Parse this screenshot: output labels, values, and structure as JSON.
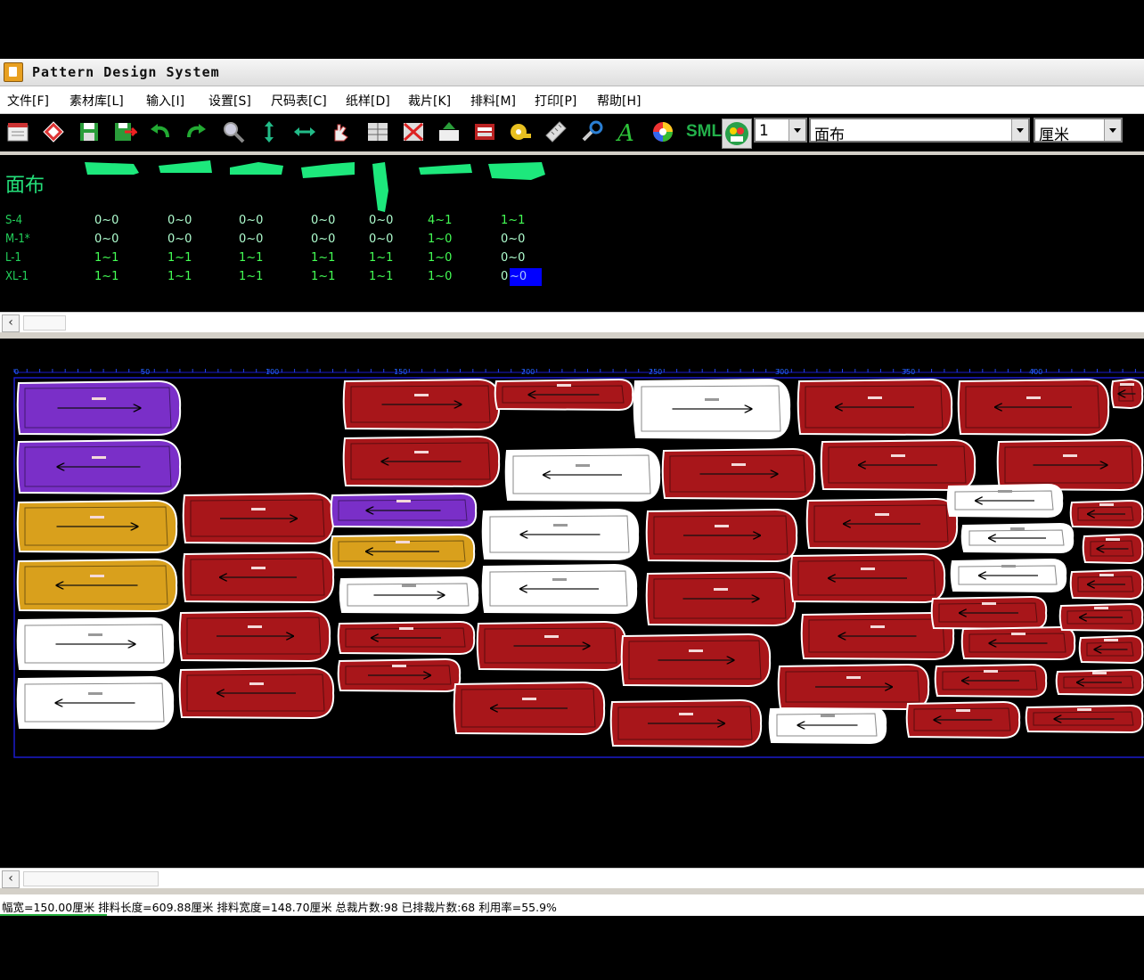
{
  "window": {
    "title": "Pattern Design System"
  },
  "menu": [
    "文件[F]",
    "素材库[L]",
    "输入[I]",
    "设置[S]",
    "尺码表[C]",
    "纸样[D]",
    "裁片[K]",
    "排料[M]",
    "打印[P]",
    "帮助[H]"
  ],
  "toolbar": {
    "icons": [
      "new-file-icon",
      "open-icon",
      "save-icon",
      "save-as-icon",
      "undo-icon",
      "redo-icon",
      "zoom-icon",
      "vertical-move-icon",
      "horizontal-move-icon",
      "hand-icon",
      "grid-icon",
      "delete-grid-icon",
      "export-icon",
      "fabric-icon",
      "measure-tape-icon",
      "ruler-icon",
      "tools-icon",
      "text-icon",
      "color-icon",
      "sml-icon",
      "user-icon"
    ],
    "sml_label": "SML",
    "layer_value": "1",
    "fabric_value": "面布",
    "unit_value": "厘米",
    "piece_color": "#1de87c"
  },
  "pieces_panel": {
    "fabric_label": "面布",
    "sizes": [
      "S-4",
      "M-1*",
      "L-1",
      "XL-1"
    ],
    "rows": [
      [
        "0~0",
        "0~0",
        "0~0",
        "0~0",
        "0~0",
        "4~1",
        "1~1"
      ],
      [
        "0~0",
        "0~0",
        "0~0",
        "0~0",
        "0~0",
        "1~0",
        "0~0"
      ],
      [
        "1~1",
        "1~1",
        "1~1",
        "1~1",
        "1~1",
        "1~0",
        "0~0"
      ],
      [
        "1~1",
        "1~1",
        "1~1",
        "1~1",
        "1~1",
        "1~0",
        "0"
      ]
    ],
    "selected_suffix": "~0"
  },
  "marker": {
    "ruler_labels": [
      "0",
      "50",
      "100",
      "150",
      "200",
      "250",
      "300",
      "350",
      "400"
    ],
    "colors": {
      "purple": "#7a2fc8",
      "gold": "#d9a01c",
      "red": "#a8161a",
      "white": "#ffffff"
    }
  },
  "status": {
    "text": "幅宽=150.00厘米 排料长度=609.88厘米 排料宽度=148.70厘米 总裁片数:98 已排裁片数:68 利用率=55.9%"
  }
}
